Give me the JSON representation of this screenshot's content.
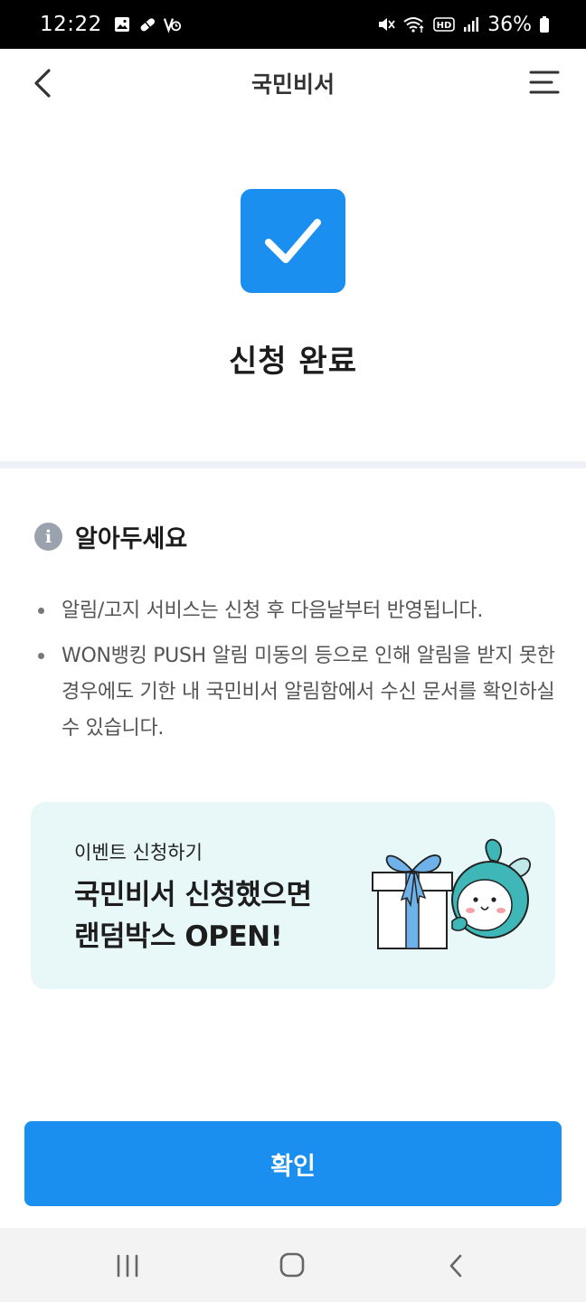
{
  "status_bar": {
    "time": "12:22",
    "battery": "36%",
    "left_icons": [
      "gallery-icon",
      "pill-icon",
      "vpn-icon"
    ],
    "right_icons": [
      "mute-icon",
      "wifi-icon",
      "hd-icon",
      "signal-icon",
      "battery-icon"
    ]
  },
  "header": {
    "title": "국민비서",
    "back_icon": "chevron-left-icon",
    "menu_icon": "hamburger-menu-icon"
  },
  "result": {
    "icon": "checkbox-checked-icon",
    "title": "신청 완료"
  },
  "notice": {
    "title": "알아두세요",
    "icon": "info-icon",
    "items": [
      "알림/고지 서비스는 신청 후 다음날부터 반영됩니다.",
      "WON뱅킹 PUSH 알림 미동의 등으로 인해 알림을 받지 못한 경우에도 기한 내 국민비서 알림함에서 수신 문서를 확인하실 수 있습니다."
    ]
  },
  "event_banner": {
    "subtitle": "이벤트 신청하기",
    "title_line1": "국민비서 신청했으면",
    "title_line2": "랜덤박스 OPEN!",
    "image": "gift-box-mascot-illustration"
  },
  "confirm_button": {
    "label": "확인"
  },
  "nav_bar": {
    "items": [
      "recent-apps-icon",
      "home-icon",
      "back-icon"
    ]
  },
  "colors": {
    "primary": "#1b8ff0",
    "banner_bg": "#e8f8f9",
    "divider": "#eef2f6"
  }
}
